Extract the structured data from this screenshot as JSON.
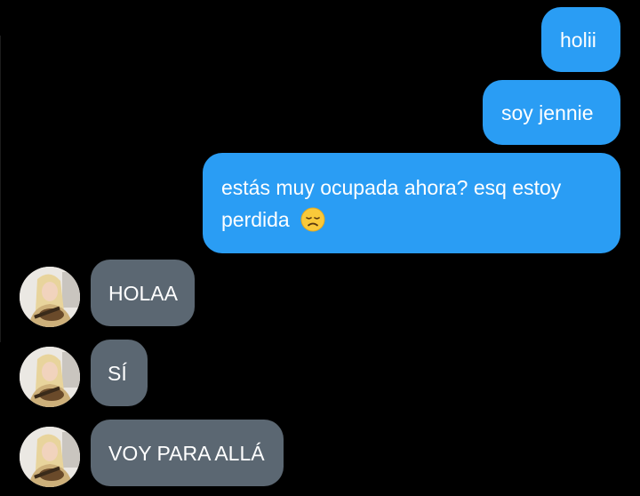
{
  "colors": {
    "background": "#000000",
    "outgoing_bubble": "#2a9df4",
    "incoming_bubble": "#5b6772",
    "text": "#ffffff"
  },
  "messages": [
    {
      "direction": "outgoing",
      "text": "holii"
    },
    {
      "direction": "outgoing",
      "text": "soy jennie"
    },
    {
      "direction": "outgoing",
      "line1": "estás muy ocupada ahora? esq estoy",
      "line2": "perdida",
      "emoji": "disappointed-face-icon"
    },
    {
      "direction": "incoming",
      "text": "HOLAA",
      "avatar": "contact-avatar"
    },
    {
      "direction": "incoming",
      "text": "SÍ",
      "avatar": "contact-avatar"
    },
    {
      "direction": "incoming",
      "text": "VOY PARA ALLÁ",
      "avatar": "contact-avatar"
    }
  ]
}
